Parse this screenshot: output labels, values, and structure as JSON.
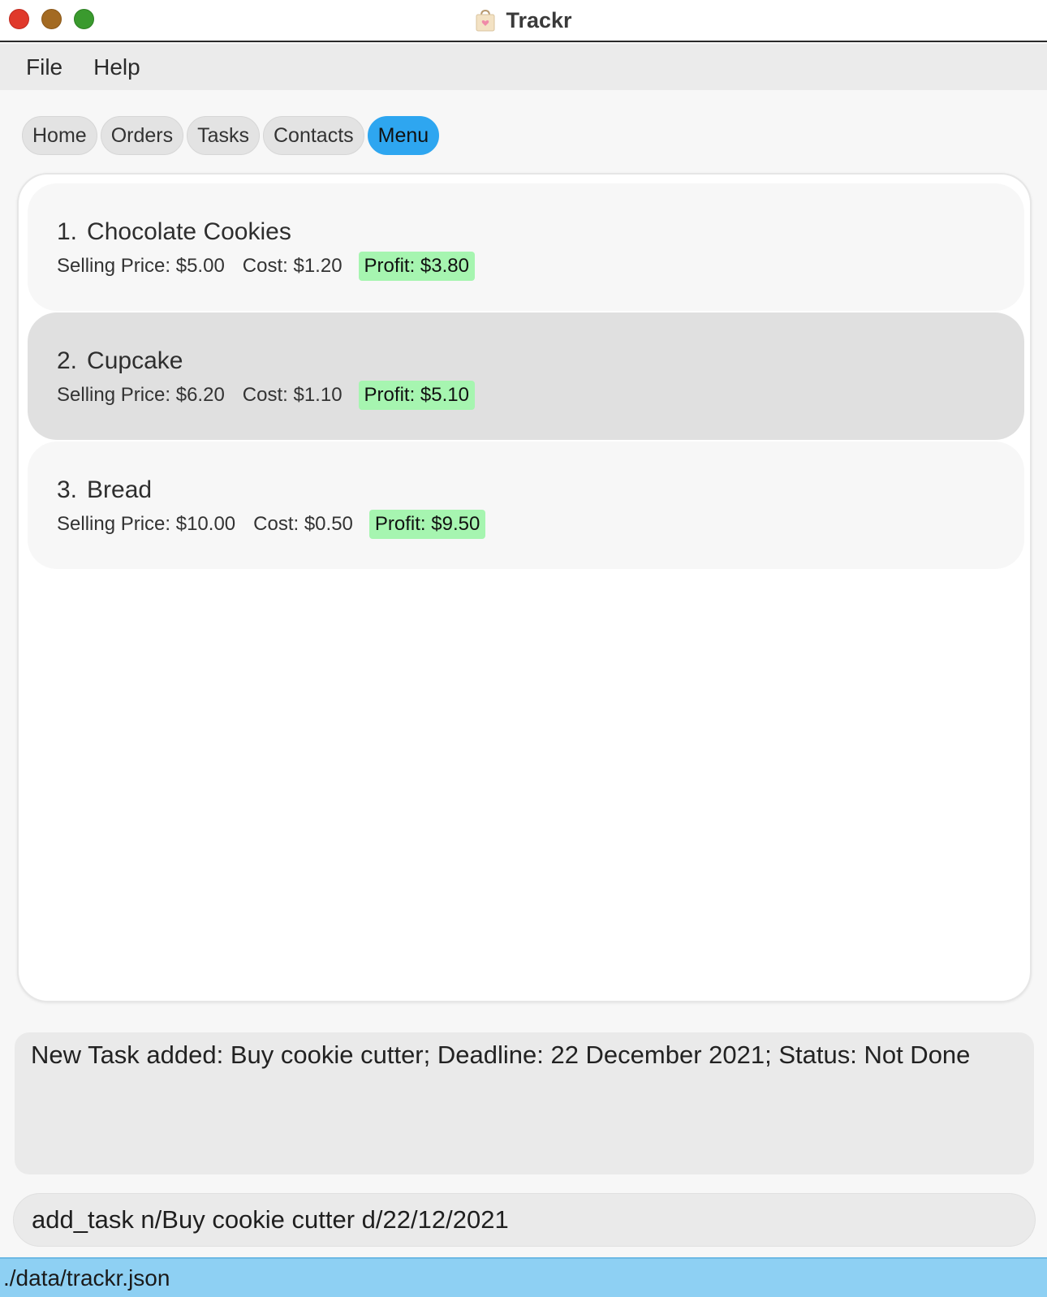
{
  "window": {
    "title": "Trackr"
  },
  "menubar": {
    "items": [
      "File",
      "Help"
    ]
  },
  "tabs": [
    {
      "label": "Home",
      "active": false
    },
    {
      "label": "Orders",
      "active": false
    },
    {
      "label": "Tasks",
      "active": false
    },
    {
      "label": "Contacts",
      "active": false
    },
    {
      "label": "Menu",
      "active": true
    }
  ],
  "menu_items": [
    {
      "index": "1.",
      "name": "Chocolate Cookies",
      "selling_price": "Selling Price: $5.00",
      "cost": "Cost: $1.20",
      "profit": "Profit: $3.80",
      "selected": false
    },
    {
      "index": "2.",
      "name": "Cupcake",
      "selling_price": "Selling Price: $6.20",
      "cost": "Cost: $1.10",
      "profit": "Profit: $5.10",
      "selected": true
    },
    {
      "index": "3.",
      "name": "Bread",
      "selling_price": "Selling Price: $10.00",
      "cost": "Cost: $0.50",
      "profit": "Profit: $9.50",
      "selected": false
    }
  ],
  "result_display": {
    "text": "New Task added: Buy cookie cutter; Deadline: 22 December 2021; Status: Not Done"
  },
  "command_box": {
    "value": "add_task n/Buy cookie cutter d/22/12/2021"
  },
  "status_bar": {
    "path": "./data/trackr.json"
  },
  "colors": {
    "accent_tab": "#2ea6f0",
    "profit_badge": "#a6f5b0",
    "status_bar": "#8ed0f3",
    "selected_card": "#e0e0e0"
  }
}
